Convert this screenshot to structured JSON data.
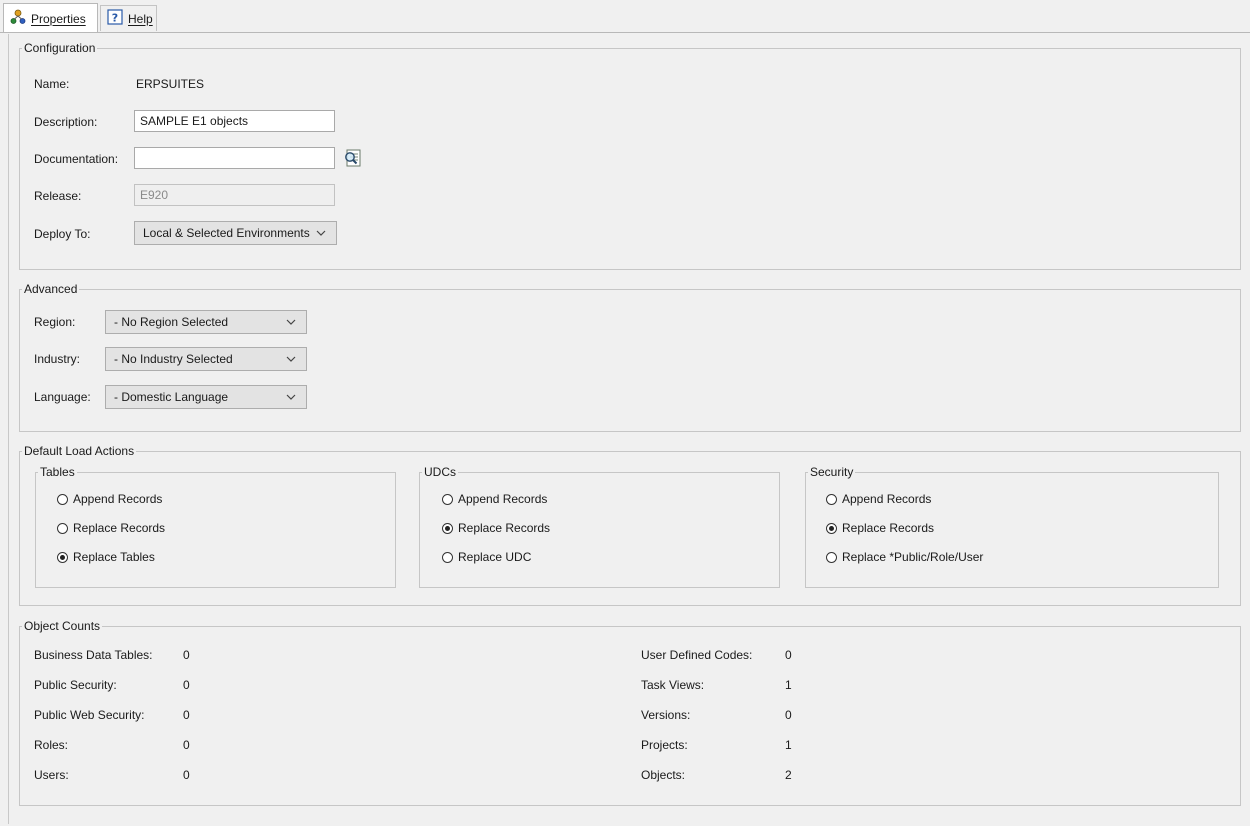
{
  "tabs": {
    "properties_label": "Properties",
    "help_label": "Help"
  },
  "configuration": {
    "legend": "Configuration",
    "name_label": "Name:",
    "name_value": "ERPSUITES",
    "description_label": "Description:",
    "description_value": "SAMPLE E1 objects",
    "documentation_label": "Documentation:",
    "documentation_value": "",
    "release_label": "Release:",
    "release_value": "E920",
    "deploy_label": "Deploy To:",
    "deploy_value": "Local & Selected Environments"
  },
  "advanced": {
    "legend": "Advanced",
    "region_label": "Region:",
    "region_value": "- No Region Selected",
    "industry_label": "Industry:",
    "industry_value": "- No Industry Selected",
    "language_label": "Language:",
    "language_value": "- Domestic Language"
  },
  "load_actions": {
    "legend": "Default Load Actions",
    "tables": {
      "legend": "Tables",
      "options": [
        "Append Records",
        "Replace Records",
        "Replace Tables"
      ],
      "selected": 2
    },
    "udcs": {
      "legend": "UDCs",
      "options": [
        "Append Records",
        "Replace Records",
        "Replace UDC"
      ],
      "selected": 1
    },
    "security": {
      "legend": "Security",
      "options": [
        "Append Records",
        "Replace Records",
        "Replace *Public/Role/User"
      ],
      "selected": 1
    }
  },
  "object_counts": {
    "legend": "Object Counts",
    "left": [
      {
        "label": "Business Data Tables:",
        "value": "0"
      },
      {
        "label": "Public Security:",
        "value": "0"
      },
      {
        "label": "Public Web Security:",
        "value": "0"
      },
      {
        "label": "Roles:",
        "value": "0"
      },
      {
        "label": "Users:",
        "value": "0"
      }
    ],
    "right": [
      {
        "label": "User Defined Codes:",
        "value": "0"
      },
      {
        "label": "Task Views:",
        "value": "1"
      },
      {
        "label": "Versions:",
        "value": "0"
      },
      {
        "label": "Projects:",
        "value": "1"
      },
      {
        "label": "Objects:",
        "value": "2"
      }
    ]
  },
  "icons": {
    "properties_tab": "properties-icon",
    "help_tab": "help-icon",
    "documentation_lookup": "search-document-icon",
    "dropdown": "chevron-down-icon"
  }
}
